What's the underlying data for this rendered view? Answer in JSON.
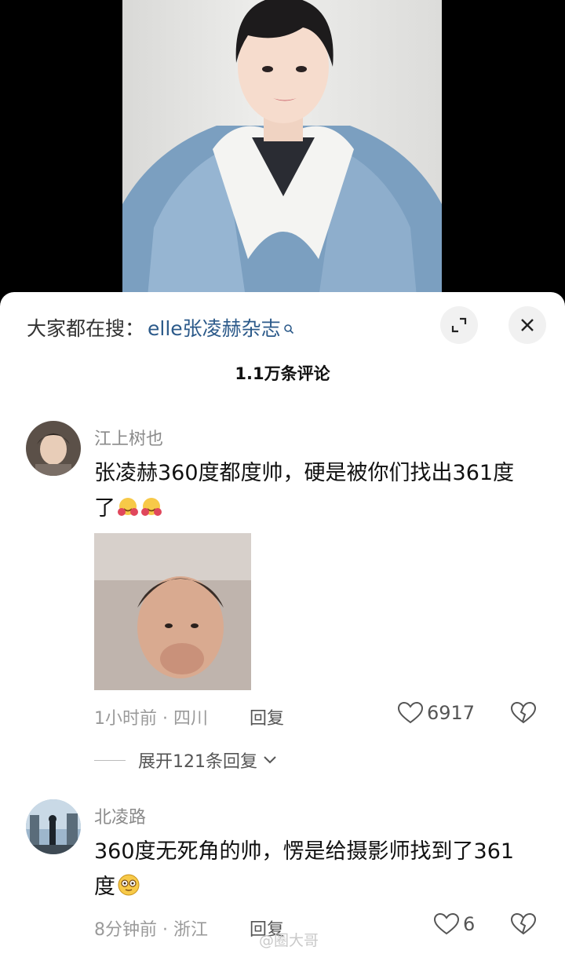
{
  "header": {
    "search_prefix": "大家都在搜：",
    "search_term": "elle张凌赫杂志",
    "comment_count": "1.1万条评论"
  },
  "comments": [
    {
      "username": "江上树也",
      "text": "张凌赫360度都度帅，硬是被你们找出361度了",
      "emoji": "hugging-face-emoji",
      "time_location": "1小时前 · 四川",
      "reply_label": "回复",
      "likes": "6917",
      "expand_replies": "展开121条回复"
    },
    {
      "username": "北凌路",
      "text": "360度无死角的帅，愣是给摄影师找到了361度",
      "emoji": "flushed-face-emoji",
      "time_location": "8分钟前 · 浙江",
      "reply_label": "回复",
      "likes": "6"
    }
  ],
  "watermark": "@圈大哥",
  "icons": {
    "search": "search-icon",
    "expand": "expand-icon",
    "close": "close-icon",
    "like": "heart-icon",
    "dislike": "broken-heart-icon",
    "chevron": "chevron-down-icon"
  },
  "colors": {
    "search_term": "#2c5a8a",
    "meta": "#9a9a9a",
    "sheet": "#ffffff"
  }
}
